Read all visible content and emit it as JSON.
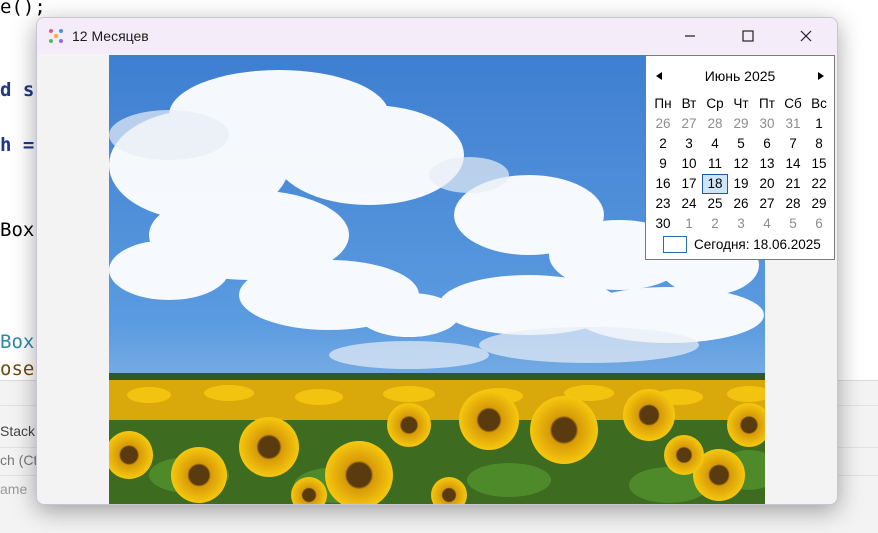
{
  "ide": {
    "code_lines": [
      {
        "text": "e();",
        "color": "#222222"
      },
      {
        "text": "d s",
        "color": "#1d3a8a"
      },
      {
        "text": "h =",
        "color": "#1d3a8a"
      },
      {
        "text": "Box",
        "color": "#222222"
      },
      {
        "text": "Box",
        "color": "#2b8aa8"
      },
      {
        "text": "ose",
        "color": "#6b4b12"
      }
    ],
    "panel_rows": [
      "Stack",
      "ch (Ct",
      "ame"
    ]
  },
  "window": {
    "title": "12 Месяцев",
    "minimize_icon": "—",
    "maximize_icon": "☐",
    "close_icon": "✕"
  },
  "calendar": {
    "month_label": "Июнь 2025",
    "weekdays": [
      "Пн",
      "Вт",
      "Ср",
      "Чт",
      "Пт",
      "Сб",
      "Вс"
    ],
    "weeks": [
      [
        {
          "d": "26",
          "o": true
        },
        {
          "d": "27",
          "o": true
        },
        {
          "d": "28",
          "o": true
        },
        {
          "d": "29",
          "o": true
        },
        {
          "d": "30",
          "o": true
        },
        {
          "d": "31",
          "o": true
        },
        {
          "d": "1",
          "o": false
        }
      ],
      [
        {
          "d": "2",
          "o": false
        },
        {
          "d": "3",
          "o": false
        },
        {
          "d": "4",
          "o": false
        },
        {
          "d": "5",
          "o": false
        },
        {
          "d": "6",
          "o": false
        },
        {
          "d": "7",
          "o": false
        },
        {
          "d": "8",
          "o": false
        }
      ],
      [
        {
          "d": "9",
          "o": false
        },
        {
          "d": "10",
          "o": false
        },
        {
          "d": "11",
          "o": false
        },
        {
          "d": "12",
          "o": false
        },
        {
          "d": "13",
          "o": false
        },
        {
          "d": "14",
          "o": false
        },
        {
          "d": "15",
          "o": false
        }
      ],
      [
        {
          "d": "16",
          "o": false
        },
        {
          "d": "17",
          "o": false
        },
        {
          "d": "18",
          "o": false,
          "sel": true
        },
        {
          "d": "19",
          "o": false
        },
        {
          "d": "20",
          "o": false
        },
        {
          "d": "21",
          "o": false
        },
        {
          "d": "22",
          "o": false
        }
      ],
      [
        {
          "d": "23",
          "o": false
        },
        {
          "d": "24",
          "o": false
        },
        {
          "d": "25",
          "o": false
        },
        {
          "d": "26",
          "o": false
        },
        {
          "d": "27",
          "o": false
        },
        {
          "d": "28",
          "o": false
        },
        {
          "d": "29",
          "o": false
        }
      ],
      [
        {
          "d": "30",
          "o": false
        },
        {
          "d": "1",
          "o": true
        },
        {
          "d": "2",
          "o": true
        },
        {
          "d": "3",
          "o": true
        },
        {
          "d": "4",
          "o": true
        },
        {
          "d": "5",
          "o": true
        },
        {
          "d": "6",
          "o": true
        }
      ]
    ],
    "today_label": "Сегодня: 18.06.2025"
  }
}
